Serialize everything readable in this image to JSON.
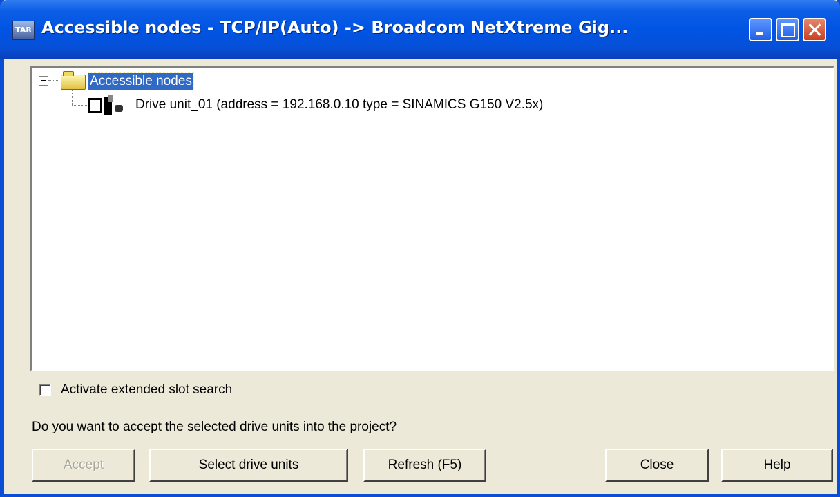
{
  "window": {
    "title": "Accessible nodes - TCP/IP(Auto) -> Broadcom NetXtreme Gig...",
    "app_icon_text": "TAR",
    "accent": "#0054e3"
  },
  "tree": {
    "root": {
      "label": "Accessible nodes",
      "icon": "folder-open-icon",
      "expanded": true,
      "selected": true
    },
    "children": [
      {
        "label": "Drive unit_01 (address = 192.168.0.10 type = SINAMICS G150 V2.5x)",
        "icon": "drive-unit-icon"
      }
    ]
  },
  "options": {
    "extended_slot_search_label": "Activate extended slot search",
    "extended_slot_search_checked": false
  },
  "prompt": {
    "question": "Do you want to accept the selected drive units into the project?"
  },
  "buttons": {
    "accept": "Accept",
    "select_drive_units": "Select drive units",
    "refresh": "Refresh (F5)",
    "close": "Close",
    "help": "Help"
  }
}
